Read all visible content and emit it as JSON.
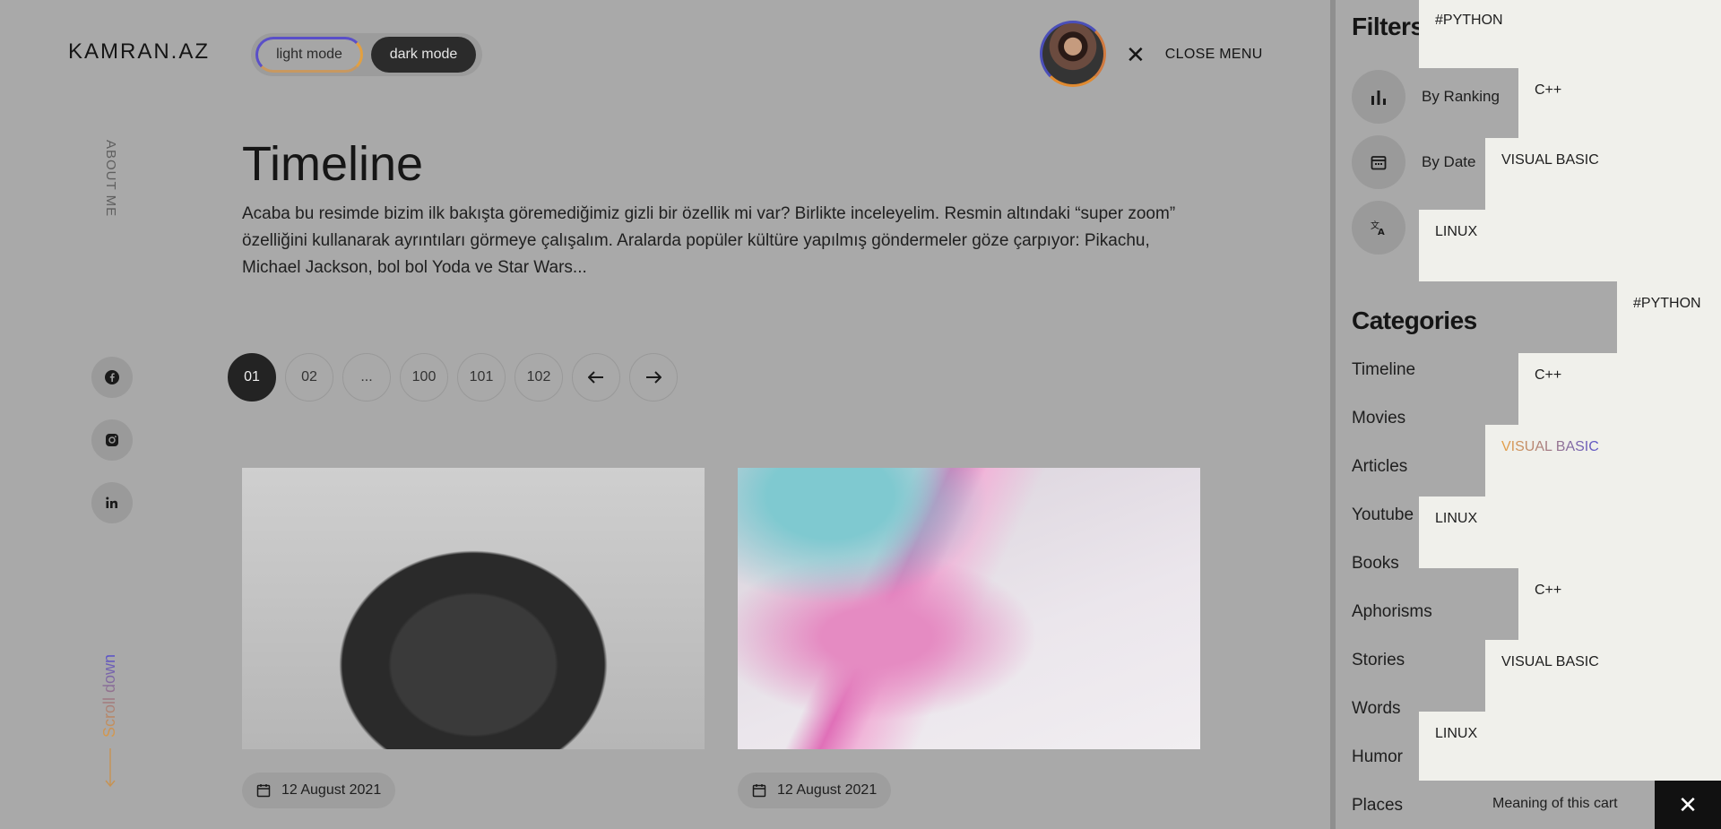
{
  "header": {
    "logo": "KAMRAN.AZ",
    "light_mode": "light mode",
    "dark_mode": "dark mode",
    "close_menu": "CLOSE MENU"
  },
  "sidebar": {
    "about": "ABOUT ME",
    "scroll": "Scroll down",
    "socials": [
      "facebook-icon",
      "instagram-icon",
      "linkedin-icon"
    ]
  },
  "main": {
    "title": "Timeline",
    "description": "Acaba bu resimde bizim ilk bakışta göremediğimiz gizli bir özellik mi var? Birlikte inceleyelim. Resmin altındaki “super zoom” özelliğini kullanarak ayrıntıları görmeye çalışalım. Aralarda popüler kültüre yapılmış göndermeler göze çarpıyor: Pikachu, Michael Jackson, bol bol Yoda ve Star Wars...",
    "pagination": [
      "01",
      "02",
      "...",
      "100",
      "101",
      "102"
    ],
    "cards": [
      {
        "date": "12 August 2021"
      },
      {
        "date": "12 August 2021"
      }
    ]
  },
  "panel": {
    "filters_title": "Filters",
    "filters": [
      "By Ranking",
      "By Date"
    ],
    "categories_title": "Categories",
    "categories": [
      "Timeline",
      "Movies",
      "Articles",
      "Youtube",
      "Books",
      "Aphorisms",
      "Stories",
      "Words",
      "Humor",
      "Places"
    ],
    "popups": [
      "#PYTHON",
      "C++",
      "VISUAL BASIC",
      "LINUX",
      "#PYTHON",
      "C++",
      "VISUAL BASIC",
      "LINUX",
      "C++",
      "VISUAL BASIC",
      "LINUX"
    ],
    "cart_label": "Meaning of this cart"
  },
  "colors": {
    "accent_blue": "#5b54c9",
    "accent_orange": "#e7a045",
    "dark": "#232323"
  }
}
